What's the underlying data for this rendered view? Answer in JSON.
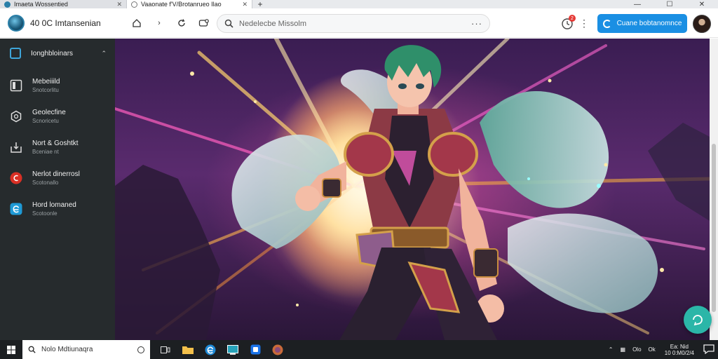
{
  "tabs": [
    {
      "label": "Imaeta Wossentied",
      "favicon_color": "#2a7fa8"
    },
    {
      "label": "Vaaonate f'V/Brotanrueo Ilao",
      "favicon_color": "#777777"
    }
  ],
  "window_controls": {
    "minimize": "—",
    "maximize": "☐",
    "close": "✕"
  },
  "header": {
    "app_title": "40 0C Imtansenian",
    "search_placeholder": "Nedelecbe Missolm",
    "search_more": "···",
    "notification_count": "2",
    "cta_label": "Cuane bobtanomnce"
  },
  "sidebar": {
    "heading": "Ionghbloinars",
    "items": [
      {
        "title": "Mebeiiild",
        "subtitle": "Snotcorlitu",
        "icon": "panel-icon"
      },
      {
        "title": "Geolecfine",
        "subtitle": "Scnoricetu",
        "icon": "hexagon-icon"
      },
      {
        "title": "Nort & Goshtkt",
        "subtitle": "Bceniae nt",
        "icon": "download-icon"
      },
      {
        "title": "Nerlot dinerrosl",
        "subtitle": "Scotonallo",
        "icon": "red-app-icon"
      },
      {
        "title": "Hord lomaned",
        "subtitle": "Scotoonle",
        "icon": "browser-e-icon"
      }
    ]
  },
  "taskbar": {
    "search_placeholder": "Nolo Mdtiunaqra",
    "clock_time": "Ea: Nid",
    "clock_date": "10 0:M0/2/4",
    "tray_label_1": "Olo",
    "tray_label_2": "Ok"
  },
  "colors": {
    "accent": "#1a8fe3",
    "sidebar_bg": "#262b2d",
    "fab": "#2bb6a8",
    "badge": "#e53935"
  }
}
